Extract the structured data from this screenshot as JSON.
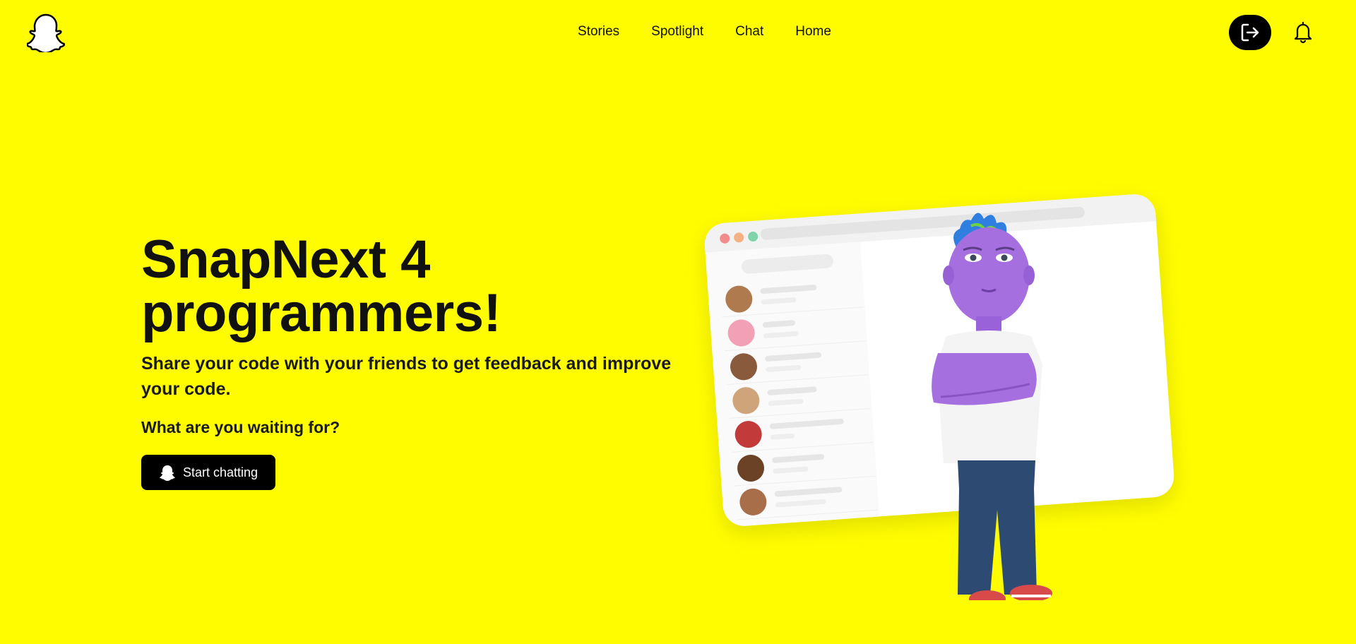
{
  "header": {
    "nav": [
      "Stories",
      "Spotlight",
      "Chat",
      "Home"
    ]
  },
  "hero": {
    "title_line1": "SnapNext 4",
    "title_line2": "programmers!",
    "subtitle": "Share your code with your friends to get feedback and improve your code.",
    "question": "What are you waiting for?",
    "cta_label": "Start chatting"
  },
  "icons": {
    "logo": "snapchat-ghost-icon",
    "logout": "logout-icon",
    "bell": "bell-icon",
    "cta": "ghost-icon"
  },
  "colors": {
    "background": "#FFFC00",
    "text": "#111111",
    "button": "#000000"
  }
}
